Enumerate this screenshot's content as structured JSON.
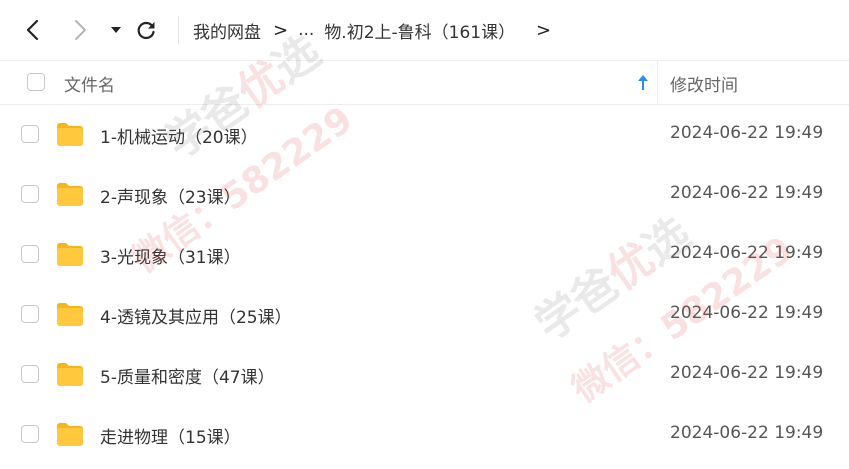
{
  "toolbar": {
    "back_icon": "chevron-left-icon",
    "forward_icon": "chevron-right-icon",
    "dropdown_icon": "caret-down-icon",
    "refresh_icon": "refresh-icon"
  },
  "breadcrumb": {
    "root": "我的网盘",
    "separator": ">",
    "ellipsis": "...",
    "current": "物.初2上-鲁科（161课）",
    "more": ">"
  },
  "header": {
    "name_label": "文件名",
    "time_label": "修改时间",
    "sort_icon": "sort-ascending-icon"
  },
  "files": [
    {
      "name": "1-机械运动（20课）",
      "modified": "2024-06-22 19:49",
      "icon": "folder-icon"
    },
    {
      "name": "2-声现象（23课）",
      "modified": "2024-06-22 19:49",
      "icon": "folder-icon"
    },
    {
      "name": "3-光现象（31课）",
      "modified": "2024-06-22 19:49",
      "icon": "folder-icon"
    },
    {
      "name": "4-透镜及其应用（25课）",
      "modified": "2024-06-22 19:49",
      "icon": "folder-icon"
    },
    {
      "name": "5-质量和密度（47课）",
      "modified": "2024-06-22 19:49",
      "icon": "folder-icon"
    },
    {
      "name": "走进物理（15课）",
      "modified": "2024-06-22 19:49",
      "icon": "folder-icon"
    }
  ],
  "watermark": {
    "line1": "学爸",
    "badge": "优",
    "line1b": "选",
    "line2": "微信：582229"
  },
  "colors": {
    "folder": "#FFC83D",
    "folder_tab": "#F5B51F",
    "sort_accent": "#2D8CF0"
  }
}
